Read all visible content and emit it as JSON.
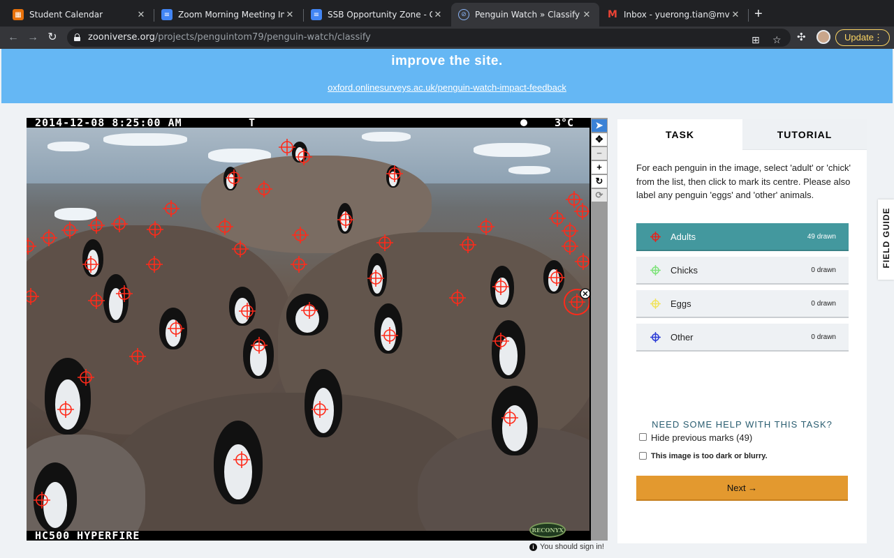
{
  "browser": {
    "tabs": [
      {
        "title": "Student Calendar",
        "icon": "calendar-icon",
        "color": "#e8710a"
      },
      {
        "title": "Zoom Morning Meeting Informa",
        "icon": "docs-icon",
        "color": "#4285f4"
      },
      {
        "title": "SSB Opportunity Zone - Googl",
        "icon": "docs-icon",
        "color": "#4285f4"
      },
      {
        "title": "Penguin Watch » Classify — Zo",
        "icon": "zooniverse-icon",
        "color": "#00979d"
      },
      {
        "title": "Inbox - yuerong.tian@mvschoo",
        "icon": "gmail-icon",
        "color": "#ea4335"
      }
    ],
    "url_host": "zooniverse.org",
    "url_path": "/projects/penguintom79/penguin-watch/classify",
    "update_label": "Update"
  },
  "banner": {
    "text": "improve the site.",
    "link": "oxford.onlinesurveys.ac.uk/penguin-watch-impact-feedback",
    "color": "#65b7f4"
  },
  "camera": {
    "datetime": "2014-12-08 8:25:00 AM",
    "marker": "T",
    "temperature": "3°C",
    "model": "HC500 HYPERFIRE",
    "brand": "RECONYX"
  },
  "signin": "You should sign in!",
  "panel": {
    "tabs": {
      "task": "TASK",
      "tutorial": "TUTORIAL"
    },
    "instructions": "For each penguin in the image, select 'adult' or 'chick' from the list, then click to mark its centre. Please also label any penguin 'eggs' and 'other' animals.",
    "choices": [
      {
        "label": "Adults",
        "count": "49 drawn",
        "color": "#e8211a",
        "selected": true
      },
      {
        "label": "Chicks",
        "count": "0 drawn",
        "color": "#7ee37a",
        "selected": false
      },
      {
        "label": "Eggs",
        "count": "0 drawn",
        "color": "#f1e35a",
        "selected": false
      },
      {
        "label": "Other",
        "count": "0 drawn",
        "color": "#2a3ad6",
        "selected": false
      }
    ],
    "help": "NEED SOME HELP WITH THIS TASK?",
    "hide_marks": "Hide previous marks (49)",
    "too_dark": "This image is too dark or blurry.",
    "next": "Next →"
  },
  "field_guide": "FIELD GUIDE"
}
